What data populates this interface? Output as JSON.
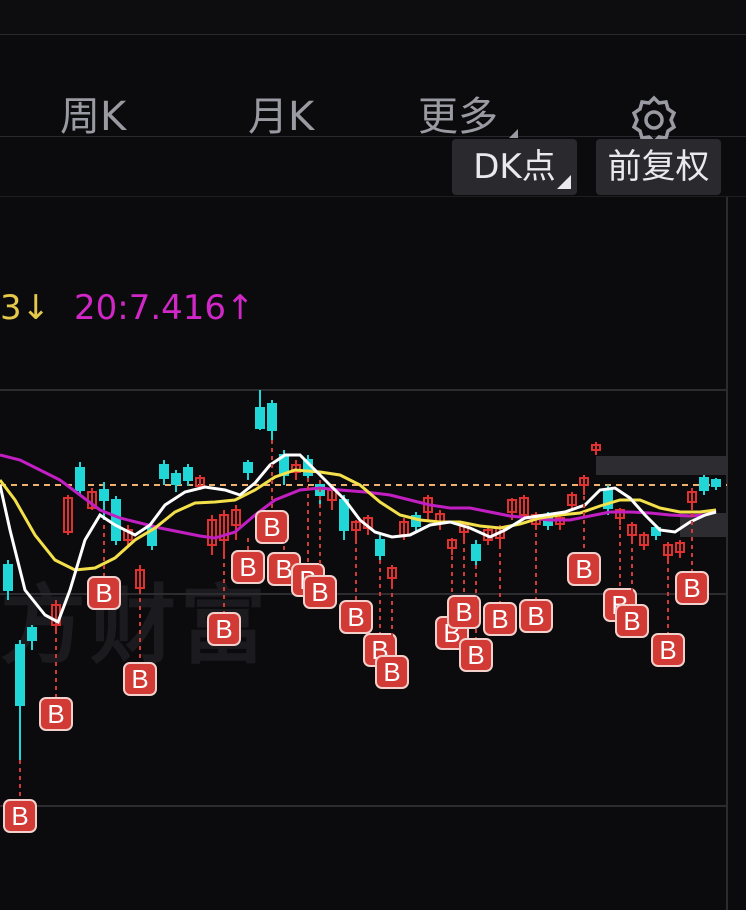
{
  "header": {
    "tabs": [
      {
        "label": "周K"
      },
      {
        "label": "月K"
      },
      {
        "label": "更多"
      }
    ]
  },
  "indicators": {
    "ma_left": "3↓",
    "ma20": "20:7.416↑",
    "dk_button": "DK点",
    "adjust_button": "前复权"
  },
  "watermark": "方财富",
  "colors": {
    "ma5": "#ffffff",
    "ma10": "#f3e04a",
    "ma20": "#c21fc2",
    "up": "#e03131",
    "down": "#20d6d6",
    "buy_marker": "#d13a35",
    "reference_line": "#f0b070"
  },
  "chart_data": {
    "type": "candlestick",
    "reference_line": "dashed",
    "buy_signals": 25,
    "buy_signal_label": "B"
  }
}
